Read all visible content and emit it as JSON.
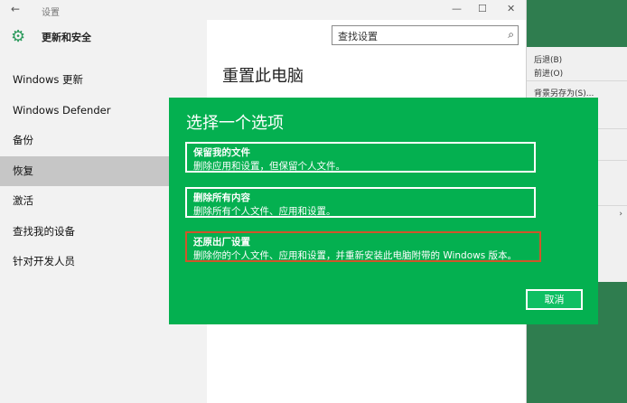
{
  "window": {
    "title": "设置",
    "back_icon": "back-arrow-icon"
  },
  "sidebar": {
    "header": "更新和安全",
    "items": [
      {
        "label": "Windows 更新",
        "active": false
      },
      {
        "label": "Windows Defender",
        "active": false
      },
      {
        "label": "备份",
        "active": false
      },
      {
        "label": "恢复",
        "active": true
      },
      {
        "label": "激活",
        "active": false
      },
      {
        "label": "查找我的设备",
        "active": false
      },
      {
        "label": "针对开发人员",
        "active": false
      }
    ]
  },
  "search": {
    "placeholder": "查找设置"
  },
  "main": {
    "title": "重置此电脑"
  },
  "context_menu": {
    "items": [
      "后退(B)",
      "前进(O)",
      "背景另存为(S)..."
    ]
  },
  "dialog": {
    "title": "选择一个选项",
    "options": [
      {
        "title": "保留我的文件",
        "desc": "删除应用和设置，但保留个人文件。",
        "highlighted": false
      },
      {
        "title": "删除所有内容",
        "desc": "删除所有个人文件、应用和设置。",
        "highlighted": false
      },
      {
        "title": "还原出厂设置",
        "desc": "删除你的个人文件、应用和设置，并重新安装此电脑附带的 Windows 版本。",
        "highlighted": true
      }
    ],
    "cancel_label": "取消",
    "background_color": "#04b050",
    "highlight_color": "#d0552a"
  }
}
